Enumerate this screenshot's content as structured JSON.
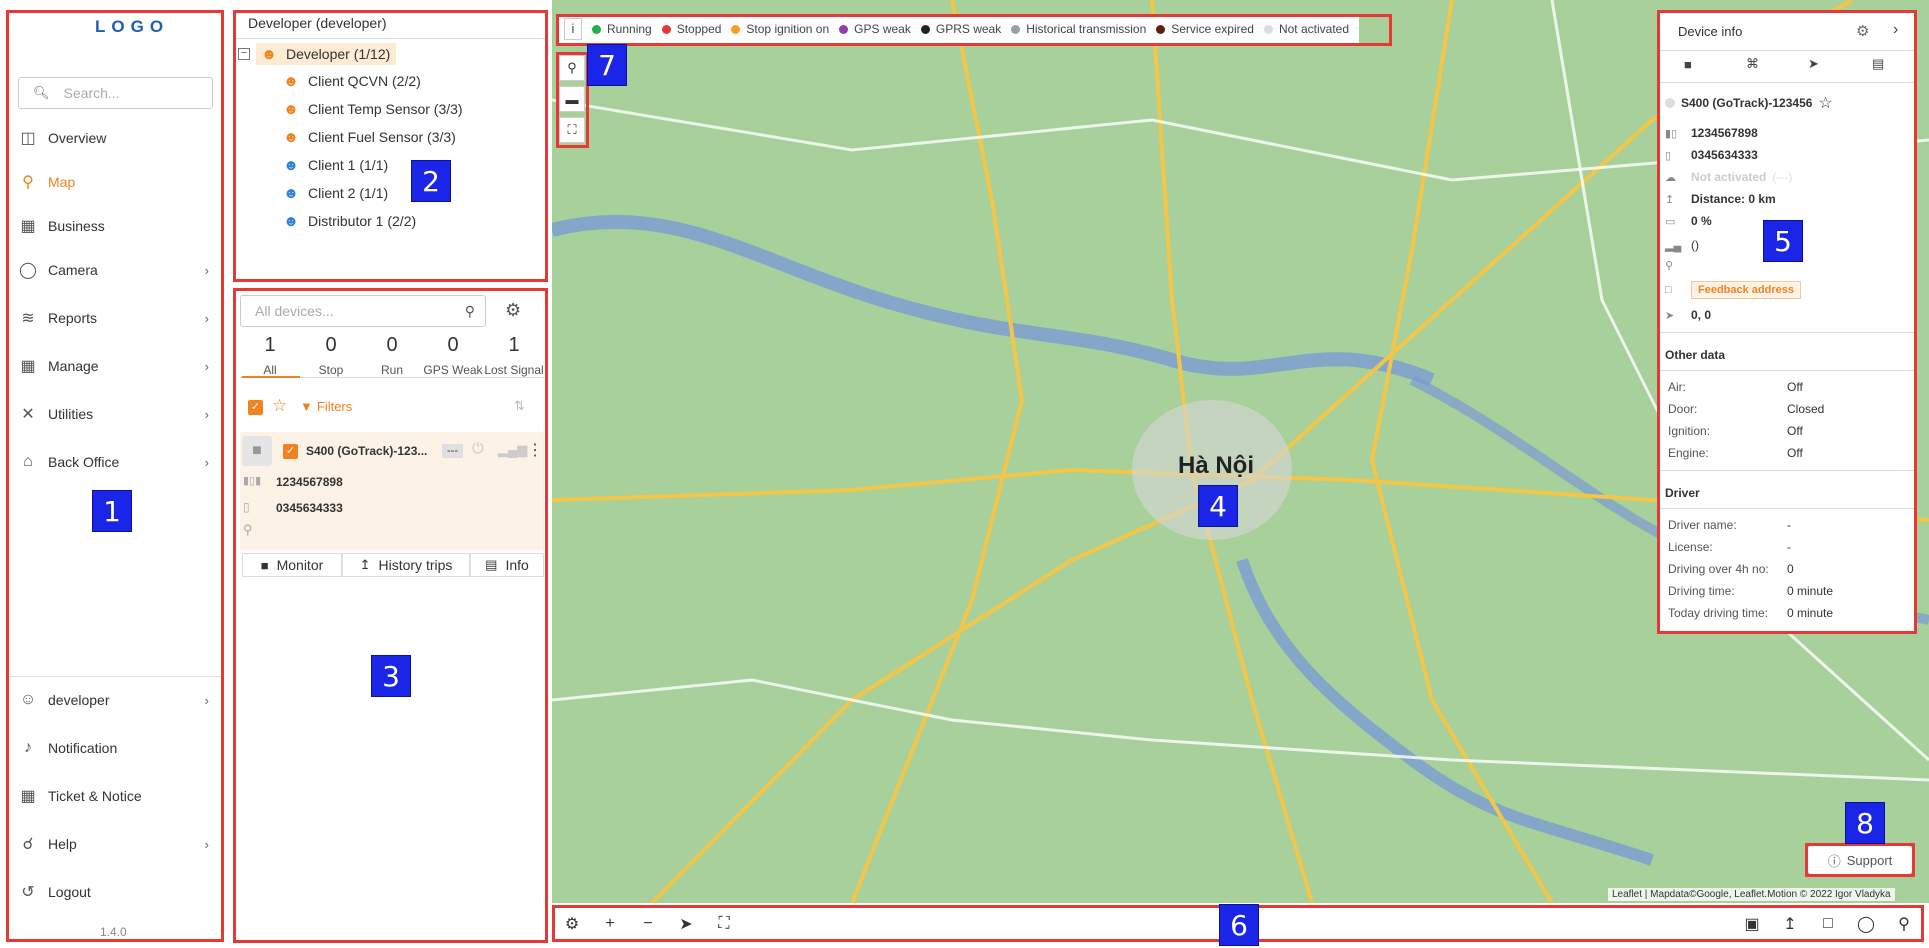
{
  "sidebar": {
    "logo": "LOGO",
    "search_placeholder": "Search...",
    "items": [
      {
        "label": "Overview",
        "icon": "overview-icon"
      },
      {
        "label": "Map",
        "icon": "map-icon",
        "active": true
      },
      {
        "label": "Business",
        "icon": "business-icon"
      },
      {
        "label": "Camera",
        "icon": "camera-icon"
      },
      {
        "label": "Reports",
        "icon": "reports-icon"
      },
      {
        "label": "Manage",
        "icon": "manage-icon"
      },
      {
        "label": "Utilities",
        "icon": "utilities-icon"
      },
      {
        "label": "Back Office",
        "icon": "back-office-icon"
      }
    ],
    "bottom_items": [
      {
        "label": "developer",
        "icon": "user-icon"
      },
      {
        "label": "Notification",
        "icon": "bell-icon"
      },
      {
        "label": "Ticket & Notice",
        "icon": "ticket-icon"
      },
      {
        "label": "Help",
        "icon": "help-icon"
      },
      {
        "label": "Logout",
        "icon": "logout-icon"
      }
    ],
    "version": "1.4.0"
  },
  "tree": {
    "title": "Developer (developer)",
    "root": "Developer (1/12)",
    "children": [
      "Client QCVN (2/2)",
      "Client Temp Sensor (3/3)",
      "Client Fuel Sensor (3/3)",
      "Client 1 (1/1)",
      "Client 2 (1/1)",
      "Distributor 1 (2/2)"
    ]
  },
  "device_list": {
    "search_placeholder": "All devices...",
    "stats": [
      {
        "n": "1",
        "label": "All"
      },
      {
        "n": "0",
        "label": "Stop"
      },
      {
        "n": "0",
        "label": "Run"
      },
      {
        "n": "0",
        "label": "GPS Weak"
      },
      {
        "n": "1",
        "label": "Lost Signal"
      }
    ],
    "filters_label": "Filters",
    "device": {
      "name": "S400 (GoTrack)-123...",
      "status": "---",
      "imei": "1234567898",
      "phone": "0345634333"
    },
    "buttons": [
      "Monitor",
      "History trips",
      "Info"
    ]
  },
  "legend": {
    "info": "i",
    "items": [
      {
        "label": "Running",
        "color": "#1fae4b"
      },
      {
        "label": "Stopped",
        "color": "#e53935"
      },
      {
        "label": "Stop ignition on",
        "color": "#f59f1c"
      },
      {
        "label": "GPS weak",
        "color": "#8e3fa8"
      },
      {
        "label": "GPRS weak",
        "color": "#222222"
      },
      {
        "label": "Historical transmission",
        "color": "#9e9e9e"
      },
      {
        "label": "Service expired",
        "color": "#5d1f12"
      },
      {
        "label": "Not activated",
        "color": "#dddddd"
      }
    ]
  },
  "map": {
    "city_label": "Hà Nội",
    "attribution": "Leaflet | Mapdata©Google, Leaflet.Motion © 2022 Igor Vladyka",
    "support": "Support"
  },
  "device_info": {
    "title": "Device info",
    "name": "S400 (GoTrack)-123456",
    "imei": "1234567898",
    "phone": "0345634333",
    "status": "Not activated",
    "status_extra": "(---)",
    "distance": "Distance: 0 km",
    "battery": "0 %",
    "signal": "()",
    "feedback": "Feedback address",
    "coords": "0, 0",
    "other_title": "Other data",
    "other": [
      {
        "k": "Air:",
        "v": "Off"
      },
      {
        "k": "Door:",
        "v": "Closed"
      },
      {
        "k": "Ignition:",
        "v": "Off"
      },
      {
        "k": "Engine:",
        "v": "Off"
      }
    ],
    "driver_title": "Driver",
    "driver": [
      {
        "k": "Driver name:",
        "v": "-"
      },
      {
        "k": "License:",
        "v": "-"
      },
      {
        "k": "Driving over 4h no:",
        "v": "0"
      },
      {
        "k": "Driving time:",
        "v": "0 minute"
      },
      {
        "k": "Today driving time:",
        "v": "0 minute"
      }
    ]
  },
  "callouts": [
    "1",
    "2",
    "3",
    "4",
    "5",
    "6",
    "7",
    "8"
  ]
}
